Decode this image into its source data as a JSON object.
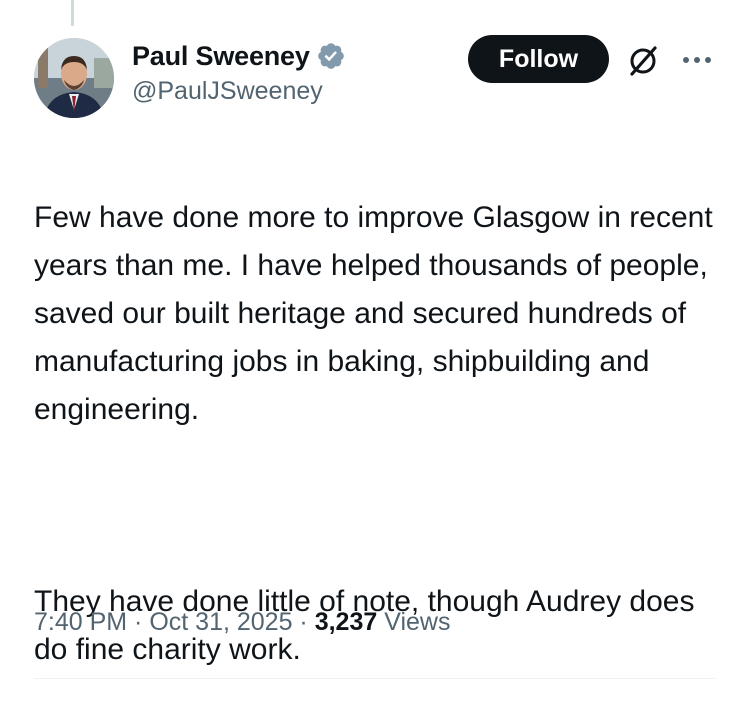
{
  "author": {
    "display_name": "Paul Sweeney",
    "handle": "@PaulJSweeney",
    "verified": true,
    "avatar_icon": "profile-photo"
  },
  "actions": {
    "follow_label": "Follow",
    "grok_icon": "grok-icon",
    "more_icon": "more-icon"
  },
  "tweet": {
    "paragraphs": [
      "Few have done more to improve Glasgow in recent years than me. I have helped thousands of people, saved our built heritage and secured hundreds of manufacturing jobs in baking, shipbuilding and engineering.",
      "They have done little of note, though Audrey does do fine charity work."
    ]
  },
  "meta": {
    "time": "7:40 PM",
    "separator": " · ",
    "date": "Oct 31, 2025",
    "views_count": "3,237",
    "views_label": "Views"
  },
  "colors": {
    "text_primary": "#0f1419",
    "text_secondary": "#536471",
    "verified_blue": "#1d9bf0",
    "follow_bg": "#0f1419",
    "divider": "#eff3f4"
  }
}
